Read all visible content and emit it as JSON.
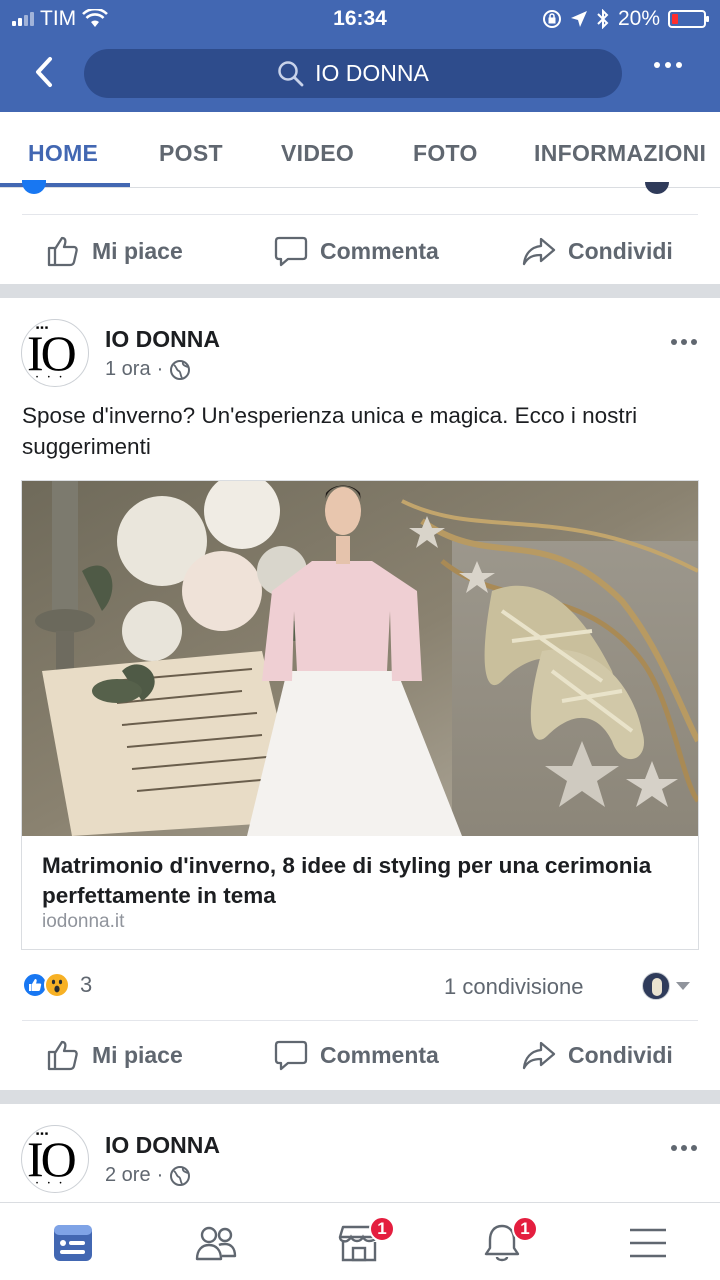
{
  "status_bar": {
    "carrier": "TIM",
    "time": "16:34",
    "battery_percent": "20%",
    "battery_level": 0.2,
    "icons": [
      "signal-icon",
      "wifi-icon",
      "lock-rotation-icon",
      "location-icon",
      "bluetooth-icon",
      "battery-icon"
    ]
  },
  "header": {
    "search_text": "IO DONNA",
    "back_icon": "chevron-left-icon",
    "more_icon": "more-horizontal-icon"
  },
  "tabs": [
    {
      "label": "HOME",
      "active": true
    },
    {
      "label": "POST",
      "active": false
    },
    {
      "label": "VIDEO",
      "active": false
    },
    {
      "label": "FOTO",
      "active": false
    },
    {
      "label": "INFORMAZIONI",
      "active": false
    }
  ],
  "actions": {
    "like": "Mi piace",
    "comment": "Commenta",
    "share": "Condividi"
  },
  "post": {
    "page_name": "IO DONNA",
    "time": "1 ora",
    "visibility_icon": "globe-icon",
    "text": "Spose d'inverno? Un'esperienza unica e magica. Ecco i nostri suggerimenti",
    "link_title": "Matrimonio d'inverno, 8 idee di styling per una cerimonia perfettamente in tema",
    "link_domain": "iodonna.it",
    "reaction_count": "3",
    "reaction_types": [
      "like",
      "wow"
    ],
    "shares": "1 condivisione"
  },
  "next_post": {
    "page_name": "IO DONNA",
    "time": "2 ore"
  },
  "bottom_nav": [
    {
      "name": "news-feed-icon",
      "badge": "",
      "active": true
    },
    {
      "name": "groups-icon",
      "badge": "",
      "active": false
    },
    {
      "name": "marketplace-icon",
      "badge": "1",
      "active": false
    },
    {
      "name": "notifications-icon",
      "badge": "1",
      "active": false
    },
    {
      "name": "menu-icon",
      "badge": "",
      "active": false
    }
  ],
  "colors": {
    "brand": "#4267b2",
    "text": "#1c1e21",
    "secondary": "#606770",
    "badge": "#e41e3f"
  }
}
